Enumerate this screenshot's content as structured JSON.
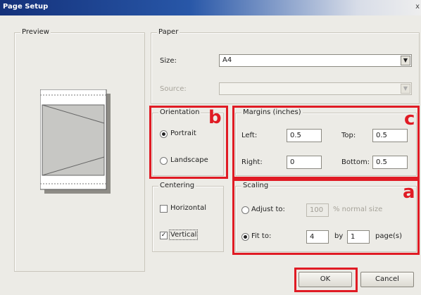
{
  "window": {
    "title": "Page Setup",
    "close_glyph": "x"
  },
  "preview": {
    "legend": "Preview"
  },
  "paper": {
    "legend": "Paper",
    "size_label": "Size:",
    "size_value": "A4",
    "source_label": "Source:",
    "source_value": ""
  },
  "orientation": {
    "legend": "Orientation",
    "portrait_label": "Portrait",
    "landscape_label": "Landscape",
    "selected": "portrait"
  },
  "margins": {
    "legend": "Margins (inches)",
    "left_label": "Left:",
    "left_value": "0.5",
    "right_label": "Right:",
    "right_value": "0",
    "top_label": "Top:",
    "top_value": "0.5",
    "bottom_label": "Bottom:",
    "bottom_value": "0.5"
  },
  "centering": {
    "legend": "Centering",
    "horizontal_label": "Horizontal",
    "horizontal_checked": false,
    "vertical_label": "Vertical",
    "vertical_checked": true
  },
  "scaling": {
    "legend": "Scaling",
    "adjust_label": "Adjust to:",
    "adjust_value": "100",
    "adjust_suffix": "% normal size",
    "fit_label": "Fit to:",
    "fit_wide": "4",
    "by_label": "by",
    "fit_tall": "1",
    "pages_suffix": "page(s)",
    "selected": "fit"
  },
  "buttons": {
    "ok": "OK",
    "cancel": "Cancel"
  },
  "annotations": {
    "a": "a",
    "b": "b",
    "c": "c",
    "color": "#e01b24"
  }
}
